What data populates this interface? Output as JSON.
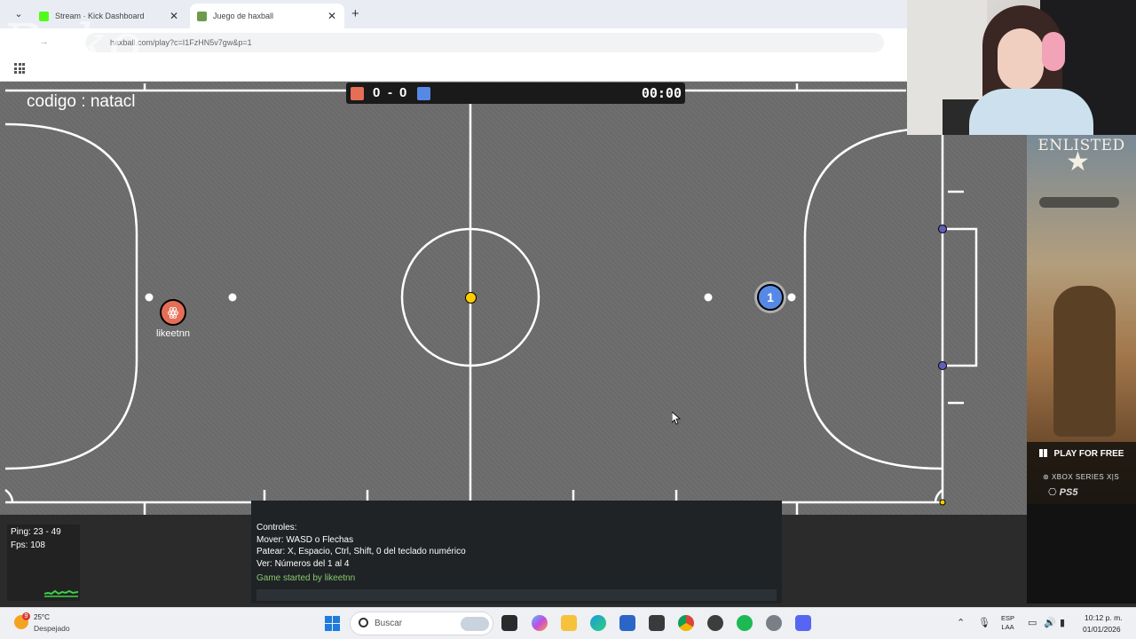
{
  "browser": {
    "tabs": [
      {
        "title": "Stream · Kick Dashboard",
        "favicon_color": "#53fc18"
      },
      {
        "title": "Juego de haxball",
        "favicon_color": "#6d9a4c"
      }
    ],
    "url": "haxball.com/play?c=I1FzHN5v7gw&p=1",
    "watermark": "Bako"
  },
  "game": {
    "room_code": "codigo : natacl",
    "score": {
      "red": "0",
      "dash": "-",
      "blue": "0"
    },
    "timer": "00:00",
    "red_player": {
      "avatar": "ꙮ",
      "name": "likeetnn",
      "color": "#e56e56"
    },
    "blue_player": {
      "avatar": "1",
      "color": "#5689e5"
    },
    "ball_color": "#ffcc00"
  },
  "stats": {
    "ping": "Ping: 23 - 49",
    "fps": "Fps: 108"
  },
  "chat": {
    "lines": [
      "Controles:",
      "Mover: WASD o Flechas",
      "Patear: X, Espacio, Ctrl, Shift, 0 del teclado numérico",
      "Ver: Números del 1 al 4"
    ],
    "notice": "Game started by likeetnn"
  },
  "ad": {
    "title": "ENLISTED",
    "play_label": "PLAY FOR FREE",
    "platform_xbox": "XBOX SERIES X|S",
    "platform_ps5": "PS5"
  },
  "taskbar": {
    "weather_badge": "9",
    "weather_temp": "25°C",
    "weather_cond": "Despejado",
    "search_label": "Buscar",
    "lang_top": "ESP",
    "lang_bottom": "LAA",
    "time": "10:12 p. m.",
    "date": "01/01/2026"
  }
}
